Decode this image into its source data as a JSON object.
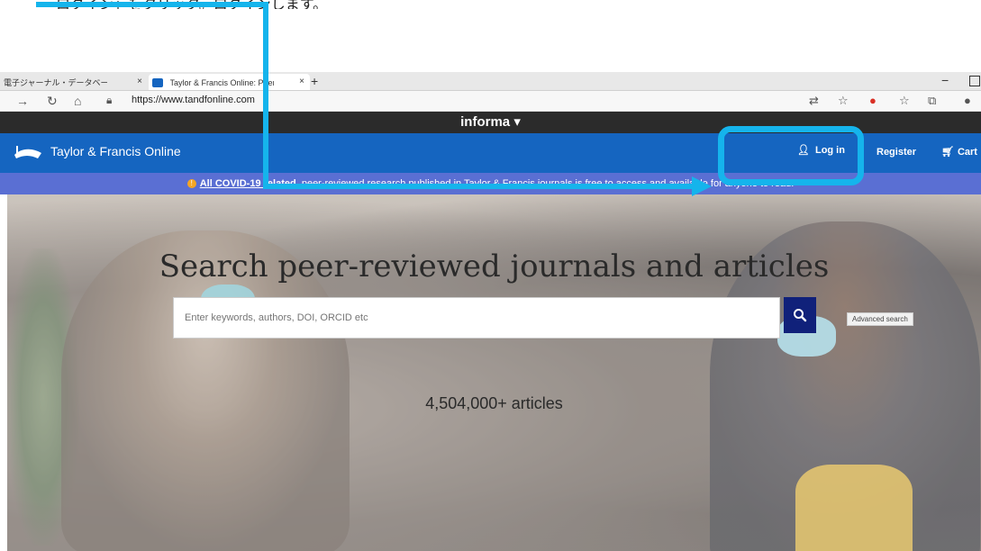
{
  "caption": {
    "text": "ログイン」をクリック。ログインします。"
  },
  "browser": {
    "tabs": [
      {
        "label": "電子ジャーナル・データベース|滋賀大学",
        "close": "×"
      },
      {
        "label": "Taylor & Francis Online: Peer-rev",
        "close": "×"
      }
    ],
    "new_tab": "+",
    "window_minimize": "−",
    "url": "https://www.tandfonline.com"
  },
  "informa": {
    "label": "informa ▾"
  },
  "header": {
    "logo_text": "Taylor & Francis Online",
    "login": "Log in",
    "register": "Register",
    "cart": "Cart"
  },
  "covid_banner": {
    "link": "All COVID-19 related",
    "text": ", peer-reviewed research published in Taylor & Francis journals is free to access and available for anyone to read."
  },
  "hero": {
    "title": "Search peer-reviewed journals and articles",
    "search_placeholder": "Enter keywords, authors, DOI, ORCID etc",
    "advanced_search": "Advanced search",
    "article_count": "4,504,000+ articles"
  },
  "colors": {
    "brand_blue": "#1565c0",
    "banner_purple": "#5a6fd3",
    "search_button": "#10217a",
    "annotation": "#15b4ec"
  }
}
